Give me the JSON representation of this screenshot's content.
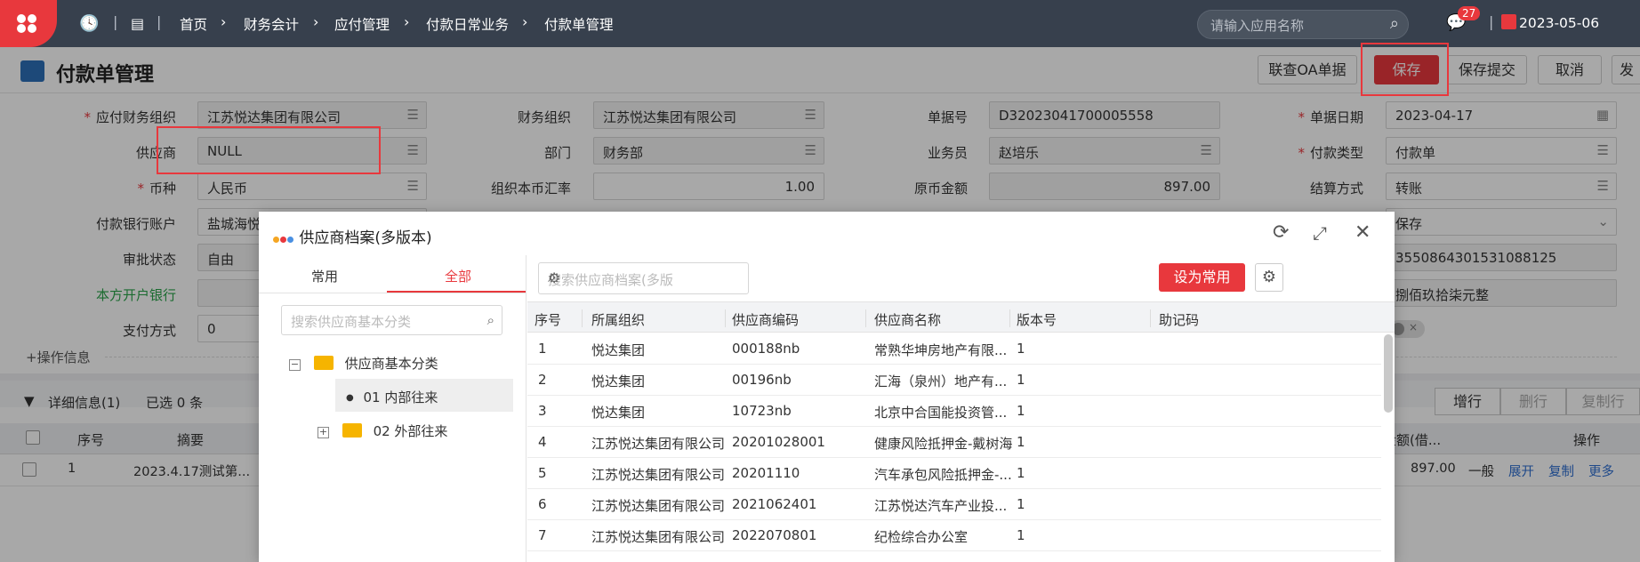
{
  "topbar": {
    "breadcrumbs": [
      "首页",
      "财务会计",
      "应付管理",
      "付款日常业务",
      "付款单管理"
    ],
    "search_placeholder": "请输入应用名称",
    "notification_count": "27",
    "date": "2023-05-06"
  },
  "page": {
    "title": "付款单管理",
    "buttons": [
      "联查OA单据",
      "保存",
      "保存提交",
      "取消",
      "发"
    ]
  },
  "form": {
    "row1": [
      {
        "label": "应付财务组织",
        "required": true,
        "value": "江苏悦达集团有限公司"
      },
      {
        "label": "财务组织",
        "value": "江苏悦达集团有限公司"
      },
      {
        "label": "单据号",
        "value": "D32023041700005558"
      },
      {
        "label": "单据日期",
        "required": true,
        "value": "2023-04-17"
      }
    ],
    "row2": [
      {
        "label": "供应商",
        "value": "NULL"
      },
      {
        "label": "部门",
        "value": "财务部"
      },
      {
        "label": "业务员",
        "value": "赵培乐"
      },
      {
        "label": "付款类型",
        "required": true,
        "value": "付款单"
      }
    ],
    "row3": [
      {
        "label": "币种",
        "required": true,
        "value": "人民币"
      },
      {
        "label": "组织本币汇率",
        "value": "1.00"
      },
      {
        "label": "原币金额",
        "value": "897.00"
      },
      {
        "label": "结算方式",
        "value": "转账"
      }
    ],
    "row4": {
      "label": "付款银行账户",
      "value": "盐城海悦",
      "right_value": "保存"
    },
    "row5": {
      "label": "审批状态",
      "value": "自由",
      "right_value": "3550864301531088125"
    },
    "row6": {
      "label": "本方开户银行",
      "value": "",
      "right_value": "捌佰玖拾柒元整"
    },
    "row7": {
      "label": "支付方式",
      "value": "0"
    },
    "ops_info": "+操作信息"
  },
  "detail": {
    "title": "详细信息(1)",
    "selected": "已选 0 条",
    "buttons": [
      "增行",
      "删行",
      "复制行"
    ],
    "headers": {
      "seq": "序号",
      "summary": "摘要",
      "amount": "金额(借...",
      "action": "操作"
    },
    "row": {
      "seq": "1",
      "summary": "2023.4.17测试第...",
      "amount": "897.00",
      "extra": "一般",
      "actions": [
        "展开",
        "复制",
        "更多"
      ]
    }
  },
  "modal": {
    "title": "供应商档案(多版本)",
    "tabs": [
      "常用",
      "全部"
    ],
    "left_search_placeholder": "搜索供应商基本分类",
    "tree": {
      "root": "供应商基本分类",
      "children": [
        "01 内部往来",
        "02 外部往来"
      ]
    },
    "right_search_placeholder": "搜索供应商档案(多版",
    "set_common_label": "设为常用",
    "columns": [
      "序号",
      "所属组织",
      "供应商编码",
      "供应商名称",
      "版本号",
      "助记码"
    ],
    "rows": [
      [
        "1",
        "悦达集团",
        "000188nb",
        "常熟华坤房地产有限...",
        "1"
      ],
      [
        "2",
        "悦达集团",
        "00196nb",
        "汇海（泉州）地产有...",
        "1"
      ],
      [
        "3",
        "悦达集团",
        "10723nb",
        "北京中合国能投资管...",
        "1"
      ],
      [
        "4",
        "江苏悦达集团有限公司",
        "20201028001",
        "健康风险抵押金-戴树海",
        "1"
      ],
      [
        "5",
        "江苏悦达集团有限公司",
        "20201110",
        "汽车承包风险抵押金-...",
        "1"
      ],
      [
        "6",
        "江苏悦达集团有限公司",
        "2021062401",
        "江苏悦达汽车产业投...",
        "1"
      ],
      [
        "7",
        "江苏悦达集团有限公司",
        "2022070801",
        "纪检综合办公室",
        "1"
      ]
    ]
  },
  "colors": {
    "accent": "#e8383d",
    "topbar": "#37404d",
    "link": "#2f6fd1"
  }
}
